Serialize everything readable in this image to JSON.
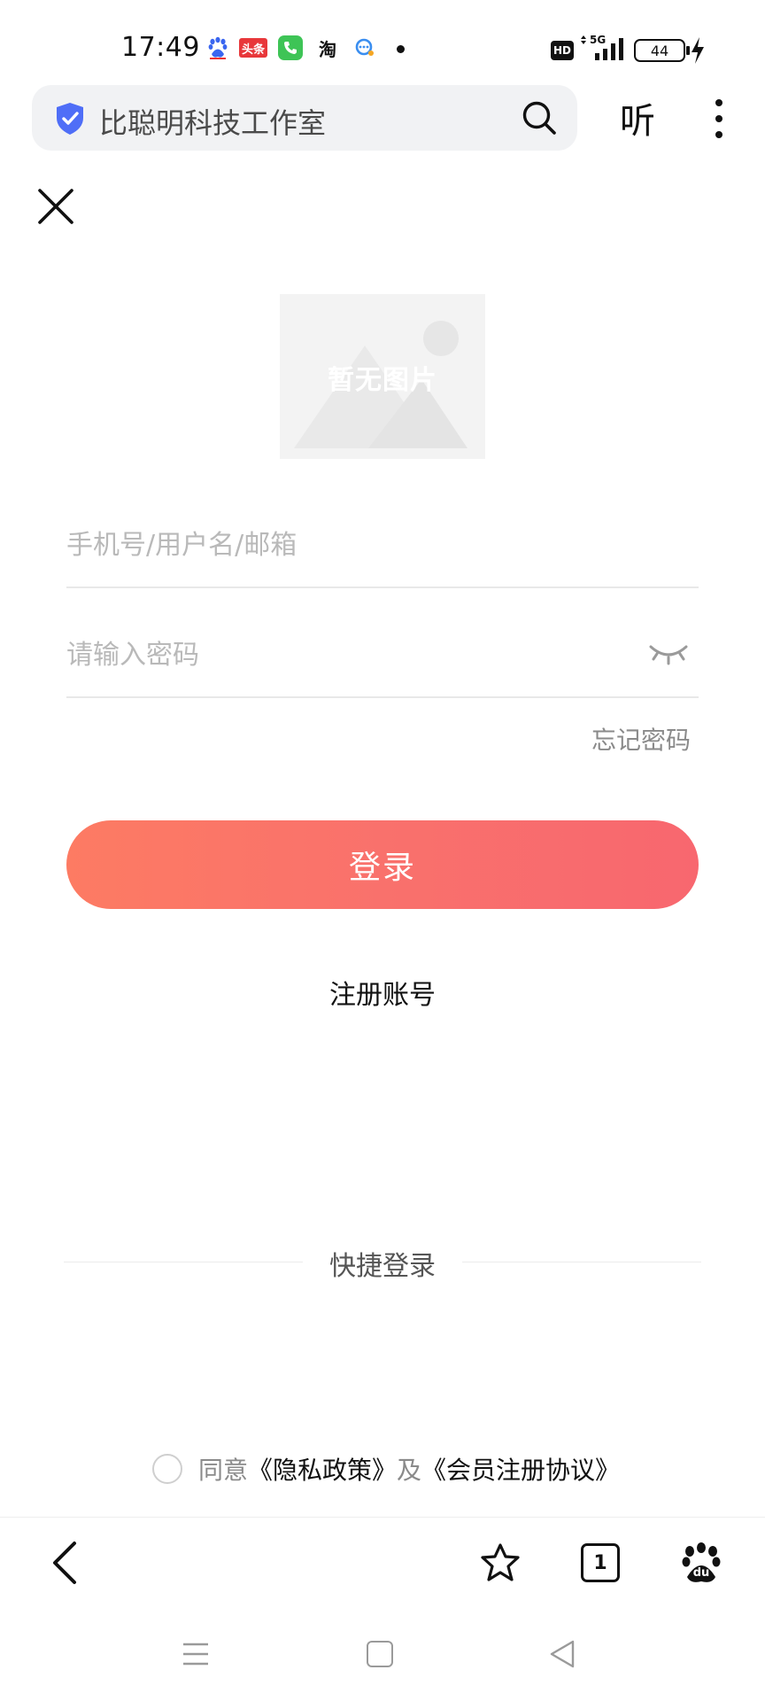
{
  "status_bar": {
    "time": "17:49",
    "app_icons": [
      "baidu-paw-icon",
      "toutiao-icon",
      "phone-icon",
      "taobao-icon",
      "chat-icon",
      "dot-icon"
    ],
    "toutiao_label": "头条",
    "taobao_label": "淘",
    "hd_label": "HD",
    "network_label": "5G",
    "battery": "44",
    "icons": [
      "hd-icon",
      "signal-5g-icon",
      "battery-icon",
      "charging-icon"
    ]
  },
  "address_bar": {
    "site_title": "比聪明科技工作室",
    "listen_label": "听",
    "icons": [
      "shield-check-icon",
      "search-icon",
      "more-vertical-icon"
    ]
  },
  "logo": {
    "placeholder_text": "暂无图片",
    "icon": "image-placeholder-icon"
  },
  "form": {
    "username_placeholder": "手机号/用户名/邮箱",
    "password_placeholder": "请输入密码",
    "forgot_password": "忘记密码",
    "login_button": "登录",
    "register_link": "注册账号",
    "quick_login_title": "快捷登录"
  },
  "agreement": {
    "agree_text": "同意",
    "privacy_policy": "《隐私政策》",
    "and_text": "及",
    "member_agreement": "《会员注册协议》"
  },
  "bottom_nav": {
    "tab_count": "1",
    "icons": [
      "back-icon",
      "star-icon",
      "tabs-icon",
      "baidu-icon"
    ],
    "baidu_label": "du"
  },
  "system_nav": {
    "icons": [
      "menu-icon",
      "home-icon",
      "back-triangle-icon"
    ]
  },
  "colors": {
    "login_gradient_start": "#fd7b63",
    "login_gradient_end": "#f8676f",
    "shield": "#4f6ef7"
  }
}
